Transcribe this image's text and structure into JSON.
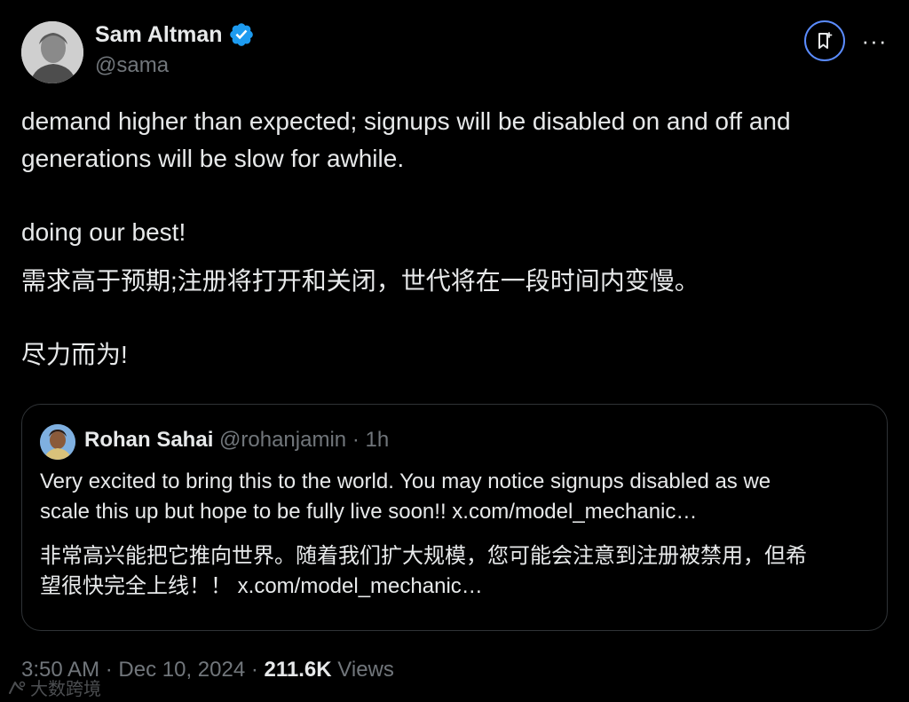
{
  "author": {
    "name": "Sam Altman",
    "handle": "@sama",
    "verified_icon": "verified-badge-icon",
    "verified_color": "#1d9bf0"
  },
  "actions": {
    "grok_icon": "grok-icon",
    "more_icon": "more-icon",
    "more_label": "···"
  },
  "tweet": {
    "lines": [
      "demand higher than expected; signups will be disabled on and off and",
      "generations will be slow for awhile.",
      "doing our best!",
      "需求高于预期;注册将打开和关闭，世代将在一段时间内变慢。",
      "尽力而为!"
    ]
  },
  "quote": {
    "name": "Rohan Sahai",
    "handle": "@rohanjamin",
    "separator": "·",
    "time": "1h",
    "lines": [
      "Very excited to bring this to the world. You may notice signups disabled as we",
      "scale this up but hope to be fully live soon!! x.com/model_mechanic…",
      "非常高兴能把它推向世界。随着我们扩大规模，您可能会注意到注册被禁用，但希",
      "望很快完全上线！！ x.com/model_mechanic…"
    ]
  },
  "meta": {
    "time": "3:50 AM",
    "separator": "·",
    "date": "Dec 10, 2024",
    "views_count": "211.6K",
    "views_label": "Views"
  },
  "watermark": {
    "text": "大数跨境"
  },
  "colors": {
    "background": "#000000",
    "text": "#e7e9ea",
    "secondary": "#71767b",
    "accent": "#1d9bf0",
    "border": "#2f3336"
  }
}
